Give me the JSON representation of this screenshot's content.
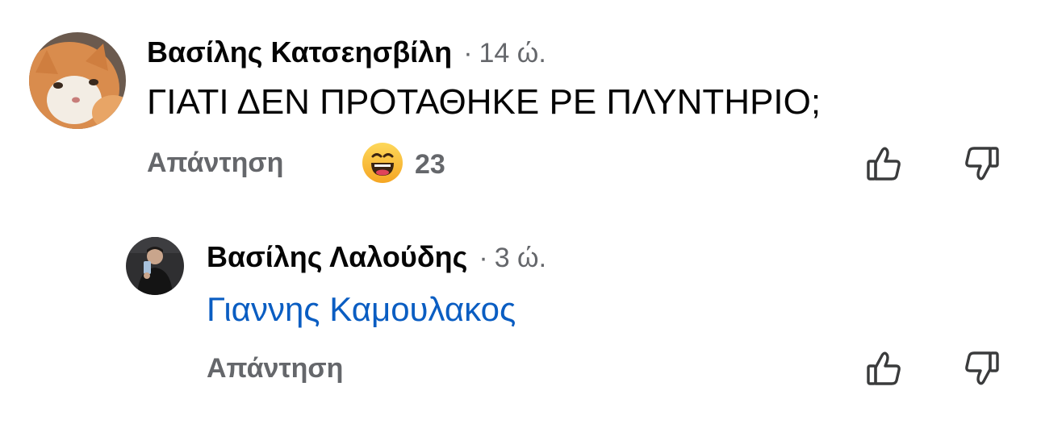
{
  "comments": [
    {
      "author": "Βασίλης Κατσεησβίλη",
      "separator": "·",
      "time": "14 ώ.",
      "text": "ΓΙΑΤΙ ΔΕΝ ΠΡΟΤΑΘΗΚΕ ΡΕ ΠΛΥΝΤΗΡΙΟ;",
      "reply_label": "Απάντηση",
      "reaction": {
        "icon": "grinning-face-emoji-icon",
        "count": "23"
      },
      "actions": [
        "thumbs-up-icon",
        "thumbs-down-icon"
      ]
    },
    {
      "author": "Βασίλης Λαλούδης",
      "separator": "·",
      "time": "3 ώ.",
      "text": "Γιαννης Καμουλακος",
      "text_is_mention": true,
      "reply_label": "Απάντηση",
      "actions": [
        "thumbs-up-icon",
        "thumbs-down-icon"
      ]
    }
  ],
  "colors": {
    "author": "#050505",
    "meta_gray": "#65676b",
    "mention_blue": "#0a5dc2",
    "emoji_yellow": "#f7b125"
  }
}
